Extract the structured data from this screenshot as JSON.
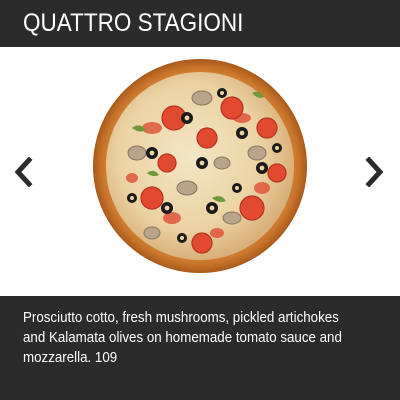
{
  "header": {
    "title": "QUATTRO STAGIONI"
  },
  "slide": {
    "image_alt": "pizza",
    "description": "Prosciutto cotto, fresh mushrooms, pickled artichokes and Kalamata olives on homemade tomato sauce and mozzarella. 109"
  },
  "nav": {
    "prev_icon": "chevron-left-icon",
    "next_icon": "chevron-right-icon"
  },
  "colors": {
    "bar": "#2b2b2b",
    "text": "#ffffff",
    "arrow": "#2b2b2b"
  }
}
